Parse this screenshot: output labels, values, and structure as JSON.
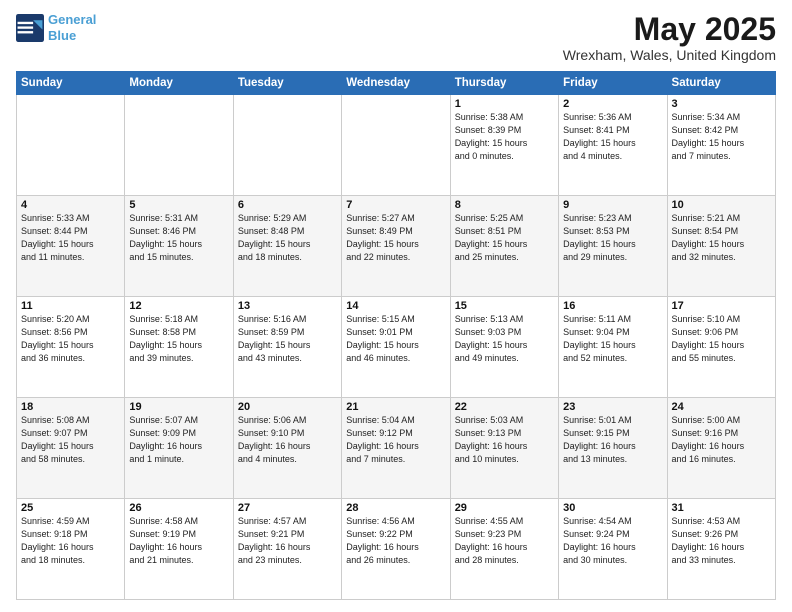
{
  "header": {
    "logo_line1": "General",
    "logo_line2": "Blue",
    "title": "May 2025",
    "location": "Wrexham, Wales, United Kingdom"
  },
  "weekdays": [
    "Sunday",
    "Monday",
    "Tuesday",
    "Wednesday",
    "Thursday",
    "Friday",
    "Saturday"
  ],
  "weeks": [
    [
      {
        "day": "",
        "info": ""
      },
      {
        "day": "",
        "info": ""
      },
      {
        "day": "",
        "info": ""
      },
      {
        "day": "",
        "info": ""
      },
      {
        "day": "1",
        "info": "Sunrise: 5:38 AM\nSunset: 8:39 PM\nDaylight: 15 hours\nand 0 minutes."
      },
      {
        "day": "2",
        "info": "Sunrise: 5:36 AM\nSunset: 8:41 PM\nDaylight: 15 hours\nand 4 minutes."
      },
      {
        "day": "3",
        "info": "Sunrise: 5:34 AM\nSunset: 8:42 PM\nDaylight: 15 hours\nand 7 minutes."
      }
    ],
    [
      {
        "day": "4",
        "info": "Sunrise: 5:33 AM\nSunset: 8:44 PM\nDaylight: 15 hours\nand 11 minutes."
      },
      {
        "day": "5",
        "info": "Sunrise: 5:31 AM\nSunset: 8:46 PM\nDaylight: 15 hours\nand 15 minutes."
      },
      {
        "day": "6",
        "info": "Sunrise: 5:29 AM\nSunset: 8:48 PM\nDaylight: 15 hours\nand 18 minutes."
      },
      {
        "day": "7",
        "info": "Sunrise: 5:27 AM\nSunset: 8:49 PM\nDaylight: 15 hours\nand 22 minutes."
      },
      {
        "day": "8",
        "info": "Sunrise: 5:25 AM\nSunset: 8:51 PM\nDaylight: 15 hours\nand 25 minutes."
      },
      {
        "day": "9",
        "info": "Sunrise: 5:23 AM\nSunset: 8:53 PM\nDaylight: 15 hours\nand 29 minutes."
      },
      {
        "day": "10",
        "info": "Sunrise: 5:21 AM\nSunset: 8:54 PM\nDaylight: 15 hours\nand 32 minutes."
      }
    ],
    [
      {
        "day": "11",
        "info": "Sunrise: 5:20 AM\nSunset: 8:56 PM\nDaylight: 15 hours\nand 36 minutes."
      },
      {
        "day": "12",
        "info": "Sunrise: 5:18 AM\nSunset: 8:58 PM\nDaylight: 15 hours\nand 39 minutes."
      },
      {
        "day": "13",
        "info": "Sunrise: 5:16 AM\nSunset: 8:59 PM\nDaylight: 15 hours\nand 43 minutes."
      },
      {
        "day": "14",
        "info": "Sunrise: 5:15 AM\nSunset: 9:01 PM\nDaylight: 15 hours\nand 46 minutes."
      },
      {
        "day": "15",
        "info": "Sunrise: 5:13 AM\nSunset: 9:03 PM\nDaylight: 15 hours\nand 49 minutes."
      },
      {
        "day": "16",
        "info": "Sunrise: 5:11 AM\nSunset: 9:04 PM\nDaylight: 15 hours\nand 52 minutes."
      },
      {
        "day": "17",
        "info": "Sunrise: 5:10 AM\nSunset: 9:06 PM\nDaylight: 15 hours\nand 55 minutes."
      }
    ],
    [
      {
        "day": "18",
        "info": "Sunrise: 5:08 AM\nSunset: 9:07 PM\nDaylight: 15 hours\nand 58 minutes."
      },
      {
        "day": "19",
        "info": "Sunrise: 5:07 AM\nSunset: 9:09 PM\nDaylight: 16 hours\nand 1 minute."
      },
      {
        "day": "20",
        "info": "Sunrise: 5:06 AM\nSunset: 9:10 PM\nDaylight: 16 hours\nand 4 minutes."
      },
      {
        "day": "21",
        "info": "Sunrise: 5:04 AM\nSunset: 9:12 PM\nDaylight: 16 hours\nand 7 minutes."
      },
      {
        "day": "22",
        "info": "Sunrise: 5:03 AM\nSunset: 9:13 PM\nDaylight: 16 hours\nand 10 minutes."
      },
      {
        "day": "23",
        "info": "Sunrise: 5:01 AM\nSunset: 9:15 PM\nDaylight: 16 hours\nand 13 minutes."
      },
      {
        "day": "24",
        "info": "Sunrise: 5:00 AM\nSunset: 9:16 PM\nDaylight: 16 hours\nand 16 minutes."
      }
    ],
    [
      {
        "day": "25",
        "info": "Sunrise: 4:59 AM\nSunset: 9:18 PM\nDaylight: 16 hours\nand 18 minutes."
      },
      {
        "day": "26",
        "info": "Sunrise: 4:58 AM\nSunset: 9:19 PM\nDaylight: 16 hours\nand 21 minutes."
      },
      {
        "day": "27",
        "info": "Sunrise: 4:57 AM\nSunset: 9:21 PM\nDaylight: 16 hours\nand 23 minutes."
      },
      {
        "day": "28",
        "info": "Sunrise: 4:56 AM\nSunset: 9:22 PM\nDaylight: 16 hours\nand 26 minutes."
      },
      {
        "day": "29",
        "info": "Sunrise: 4:55 AM\nSunset: 9:23 PM\nDaylight: 16 hours\nand 28 minutes."
      },
      {
        "day": "30",
        "info": "Sunrise: 4:54 AM\nSunset: 9:24 PM\nDaylight: 16 hours\nand 30 minutes."
      },
      {
        "day": "31",
        "info": "Sunrise: 4:53 AM\nSunset: 9:26 PM\nDaylight: 16 hours\nand 33 minutes."
      }
    ]
  ]
}
